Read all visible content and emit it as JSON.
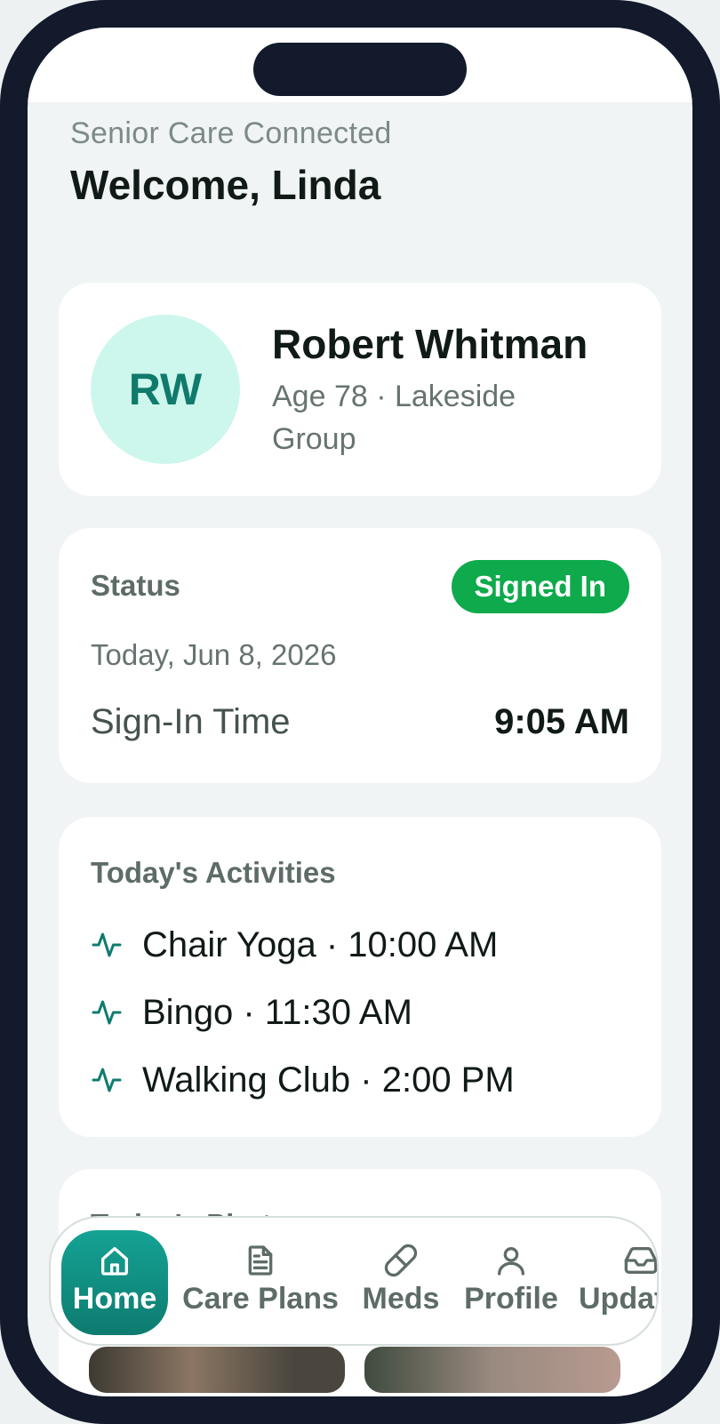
{
  "app": {
    "subtitle": "Senior Care Connected",
    "title": "Welcome, Linda"
  },
  "profile": {
    "initials": "RW",
    "name": "Robert Whitman",
    "meta": "Age 78 · Lakeside Group"
  },
  "status": {
    "label": "Status",
    "badge": "Signed In",
    "date": "Today, Jun 8, 2026",
    "signin_label": "Sign-In Time",
    "signin_time": "9:05 AM"
  },
  "activities": {
    "label": "Today's Activities",
    "items": [
      {
        "text": "Chair Yoga · 10:00 AM",
        "icon": "pulse-icon"
      },
      {
        "text": "Bingo · 11:30 AM",
        "icon": "pulse-icon"
      },
      {
        "text": "Walking Club · 2:00 PM",
        "icon": "pulse-icon"
      }
    ]
  },
  "photos": {
    "label": "Today's Photos"
  },
  "tabs": [
    {
      "label": "Home",
      "icon": "home-icon",
      "active": true
    },
    {
      "label": "Care Plans",
      "icon": "document-icon",
      "active": false
    },
    {
      "label": "Meds",
      "icon": "pill-icon",
      "active": false
    },
    {
      "label": "Profile",
      "icon": "user-icon",
      "active": false
    },
    {
      "label": "Updates",
      "icon": "inbox-icon",
      "active": false
    }
  ],
  "colors": {
    "accent": "#0e7b6f",
    "badge": "#0eaa4c",
    "avatar_bg": "#cdf7ec"
  }
}
